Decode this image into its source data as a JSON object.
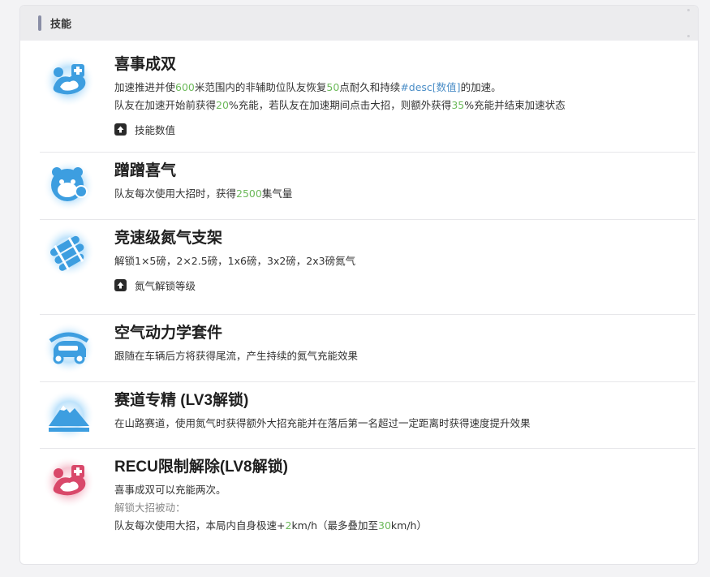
{
  "header": {
    "title": "技能"
  },
  "skills": [
    {
      "name": "喜事成双",
      "line1": {
        "a": "加速推进并使",
        "v1": "600",
        "b": "米范围内的非辅助位队友恢复",
        "v2": "50",
        "c": "点耐久和持续",
        "v3": "#desc[数值]",
        "d": "的加速。"
      },
      "line2": {
        "a": "队友在加速开始前获得",
        "v1": "20",
        "b": "%充能，若队友在加速期间点击大招，则额外获得",
        "v2": "35",
        "c": "%充能并结束加速状态"
      },
      "expander": "技能数值",
      "icon": "gift-car-icon"
    },
    {
      "name": "蹭蹭喜气",
      "line1": {
        "a": "队友每次使用大招时，获得",
        "v1": "2500",
        "b": "集气量"
      },
      "icon": "tiger-mascot-icon"
    },
    {
      "name": "竞速级氮气支架",
      "line1": {
        "a": "解锁1×5磅，2×2.5磅，1x6磅，3x2磅，2x3磅氮气"
      },
      "expander": "氮气解锁等级",
      "icon": "nitro-rack-icon"
    },
    {
      "name": "空气动力学套件",
      "line1": {
        "a": "跟随在车辆后方将获得尾流，产生持续的氮气充能效果"
      },
      "icon": "aero-car-icon"
    },
    {
      "name": "赛道专精 (LV3解锁)",
      "line1": {
        "a": "在山路赛道，使用氮气时获得额外大招充能并在落后第一名超过一定距离时获得速度提升效果"
      },
      "icon": "mountain-icon"
    },
    {
      "name": "RECU限制解除(LV8解锁)",
      "line1": {
        "a": "喜事成双可以充能两次。"
      },
      "line2": {
        "a": "解锁大招被动："
      },
      "line3": {
        "a": "队友每次使用大招，本局内自身极速+",
        "v1": "2",
        "b": "km/h（最多叠加至",
        "v2": "30",
        "c": "km/h）"
      },
      "icon": "gift-car-red-icon"
    }
  ],
  "colors": {
    "highlight_green": "#6cb95a",
    "highlight_blue": "#4b8ec7",
    "icon_blue": "#3d9ee0",
    "icon_red": "#d9486a"
  }
}
